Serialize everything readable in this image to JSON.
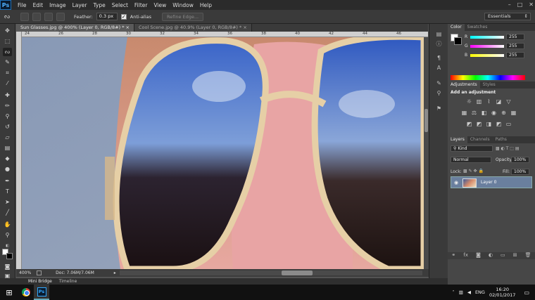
{
  "app": {
    "logo": "Ps"
  },
  "menubar": [
    "File",
    "Edit",
    "Image",
    "Layer",
    "Type",
    "Select",
    "Filter",
    "View",
    "Window",
    "Help"
  ],
  "window_controls": {
    "minimize": "–",
    "maximize": "□",
    "close": "✕"
  },
  "options": {
    "feather_label": "Feather:",
    "feather_value": "0.3 px",
    "antialias_label": "Anti-alias",
    "refine_label": "Refine Edge...",
    "workspace": "Essentials"
  },
  "tabs": [
    {
      "label": "Sun Glasses.jpg @ 400% (Layer 0, RGB/8#) *",
      "close": "×"
    },
    {
      "label": "Cool Scene.jpg @ 40.9% (Layer 0, RGB/8#) *",
      "close": "×"
    }
  ],
  "ruler_ticks": [
    "24",
    "26",
    "28",
    "30",
    "32",
    "34",
    "36",
    "38",
    "40",
    "42",
    "44",
    "46"
  ],
  "status": {
    "zoom": "400%",
    "doc": "Doc: 7.06M/7.06M"
  },
  "bottom_tabs": [
    "Mini Bridge",
    "Timeline"
  ],
  "color_panel": {
    "tabs": [
      "Color",
      "Swatches"
    ],
    "channels": [
      {
        "label": "R",
        "value": "255"
      },
      {
        "label": "G",
        "value": "255"
      },
      {
        "label": "B",
        "value": "255"
      }
    ],
    "fg_color": "#ffffff",
    "bg_color": "#000000"
  },
  "adjustments_panel": {
    "tabs": [
      "Adjustments",
      "Styles"
    ],
    "title": "Add an adjustment"
  },
  "layers_panel": {
    "tabs": [
      "Layers",
      "Channels",
      "Paths"
    ],
    "kind": "Kind",
    "blend": "Normal",
    "opacity_label": "Opacity:",
    "opacity": "100%",
    "lock_label": "Lock:",
    "fill_label": "Fill:",
    "fill": "100%",
    "layer_name": "Layer 0"
  },
  "taskbar": {
    "lang": "ENG",
    "time": "16:20",
    "date": "02/01/2017"
  }
}
